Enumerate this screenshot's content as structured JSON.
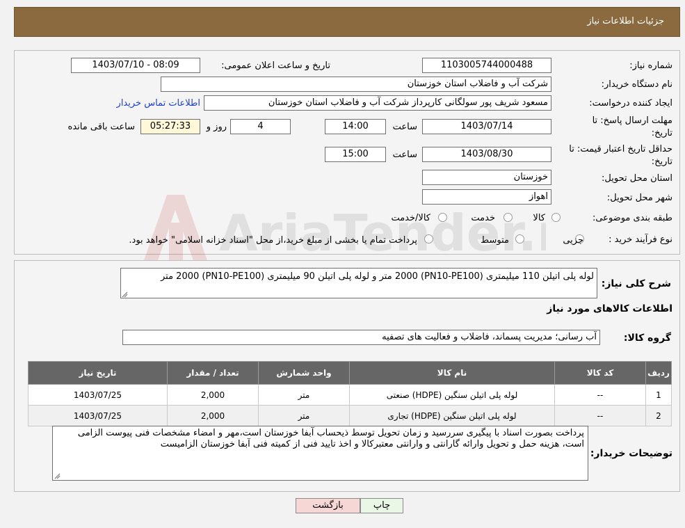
{
  "header": {
    "title": "جزئیات اطلاعات نیاز"
  },
  "form": {
    "need_number_label": "شماره نیاز:",
    "need_number": "1103005744000488",
    "announce_label": "تاریخ و ساعت اعلان عمومی:",
    "announce_value": "1403/07/10 - 08:09",
    "buyer_org_label": "نام دستگاه خریدار:",
    "buyer_org": "شرکت آب و فاضلاب استان خوزستان",
    "creator_label": "ایجاد کننده درخواست:",
    "creator": "مسعود شریف پور سولگانی کارپرداز شرکت آب و فاضلاب استان خوزستان",
    "contact_link": "اطلاعات تماس خریدار",
    "reply_deadline_label_1": "مهلت ارسال پاسخ: تا",
    "reply_deadline_label_2": "تاریخ:",
    "reply_date": "1403/07/14",
    "time_label": "ساعت",
    "reply_time": "14:00",
    "days_value": "4",
    "days_label": "روز و",
    "remaining_time": "05:27:33",
    "remaining_label": "ساعت باقی مانده",
    "validity_label_1": "حداقل تاریخ اعتبار قیمت: تا",
    "validity_label_2": "تاریخ:",
    "validity_date": "1403/08/30",
    "validity_time": "15:00",
    "province_label": "استان محل تحویل:",
    "province": "خوزستان",
    "city_label": "شهر محل تحویل:",
    "city": "اهواز",
    "category_label": "طبقه بندی موضوعی:",
    "category_options": [
      "کالا",
      "خدمت",
      "کالا/خدمت"
    ],
    "process_label": "نوع فرآیند خرید :",
    "process_options": [
      "جزیی",
      "متوسط"
    ],
    "process_note": "پرداخت تمام یا بخشی از مبلغ خرید،از محل \"اسناد خزانه اسلامی\" خواهد بود."
  },
  "summary": {
    "description_label": "شرح کلی نیاز:",
    "description": "لوله پلی اتیلن 110 میلیمتری (PN10-PE100) 2000 متر و لوله پلی اتیلن 90 میلیمتری (PN10-PE100) 2000 متر",
    "goods_info_title": "اطلاعات کالاهای مورد نیاز",
    "goods_group_label": "گروه کالا:",
    "goods_group": "آب رسانی؛ مدیریت پسماند، فاضلاب و فعالیت های تصفیه"
  },
  "table": {
    "headers": [
      "ردیف",
      "کد کالا",
      "نام کالا",
      "واحد شمارش",
      "تعداد / مقدار",
      "تاریخ نیاز"
    ],
    "rows": [
      [
        "1",
        "--",
        "لوله پلی اتیلن سنگین (HDPE) صنعتی",
        "متر",
        "2,000",
        "1403/07/25"
      ],
      [
        "2",
        "--",
        "لوله پلی اتیلن سنگین (HDPE) تجاری",
        "متر",
        "2,000",
        "1403/07/25"
      ]
    ]
  },
  "buyer_notes": {
    "label": "توضیحات خریدار:",
    "text": "پرداخت بصورت اسناد با پیگیری  سررسید و زمان تحویل توسط ذیحساب آبفا خوزستان است،مهر و امضاء مشخصات فنی پیوست الزامی است، هزینه حمل و تحویل وارائه گارانتی و وارانتی معتبرکالا و اخذ تایید فنی از کمیته فنی آبفا خوزستان الزامیست"
  },
  "buttons": {
    "print": "چاپ",
    "back": "بازگشت"
  },
  "watermark": {
    "text": "AriaTender.neT"
  },
  "colors": {
    "header_bg": "#8b6a40",
    "table_header": "#666666",
    "link": "#1d3fc9",
    "back_button": "#f7d6d6"
  }
}
